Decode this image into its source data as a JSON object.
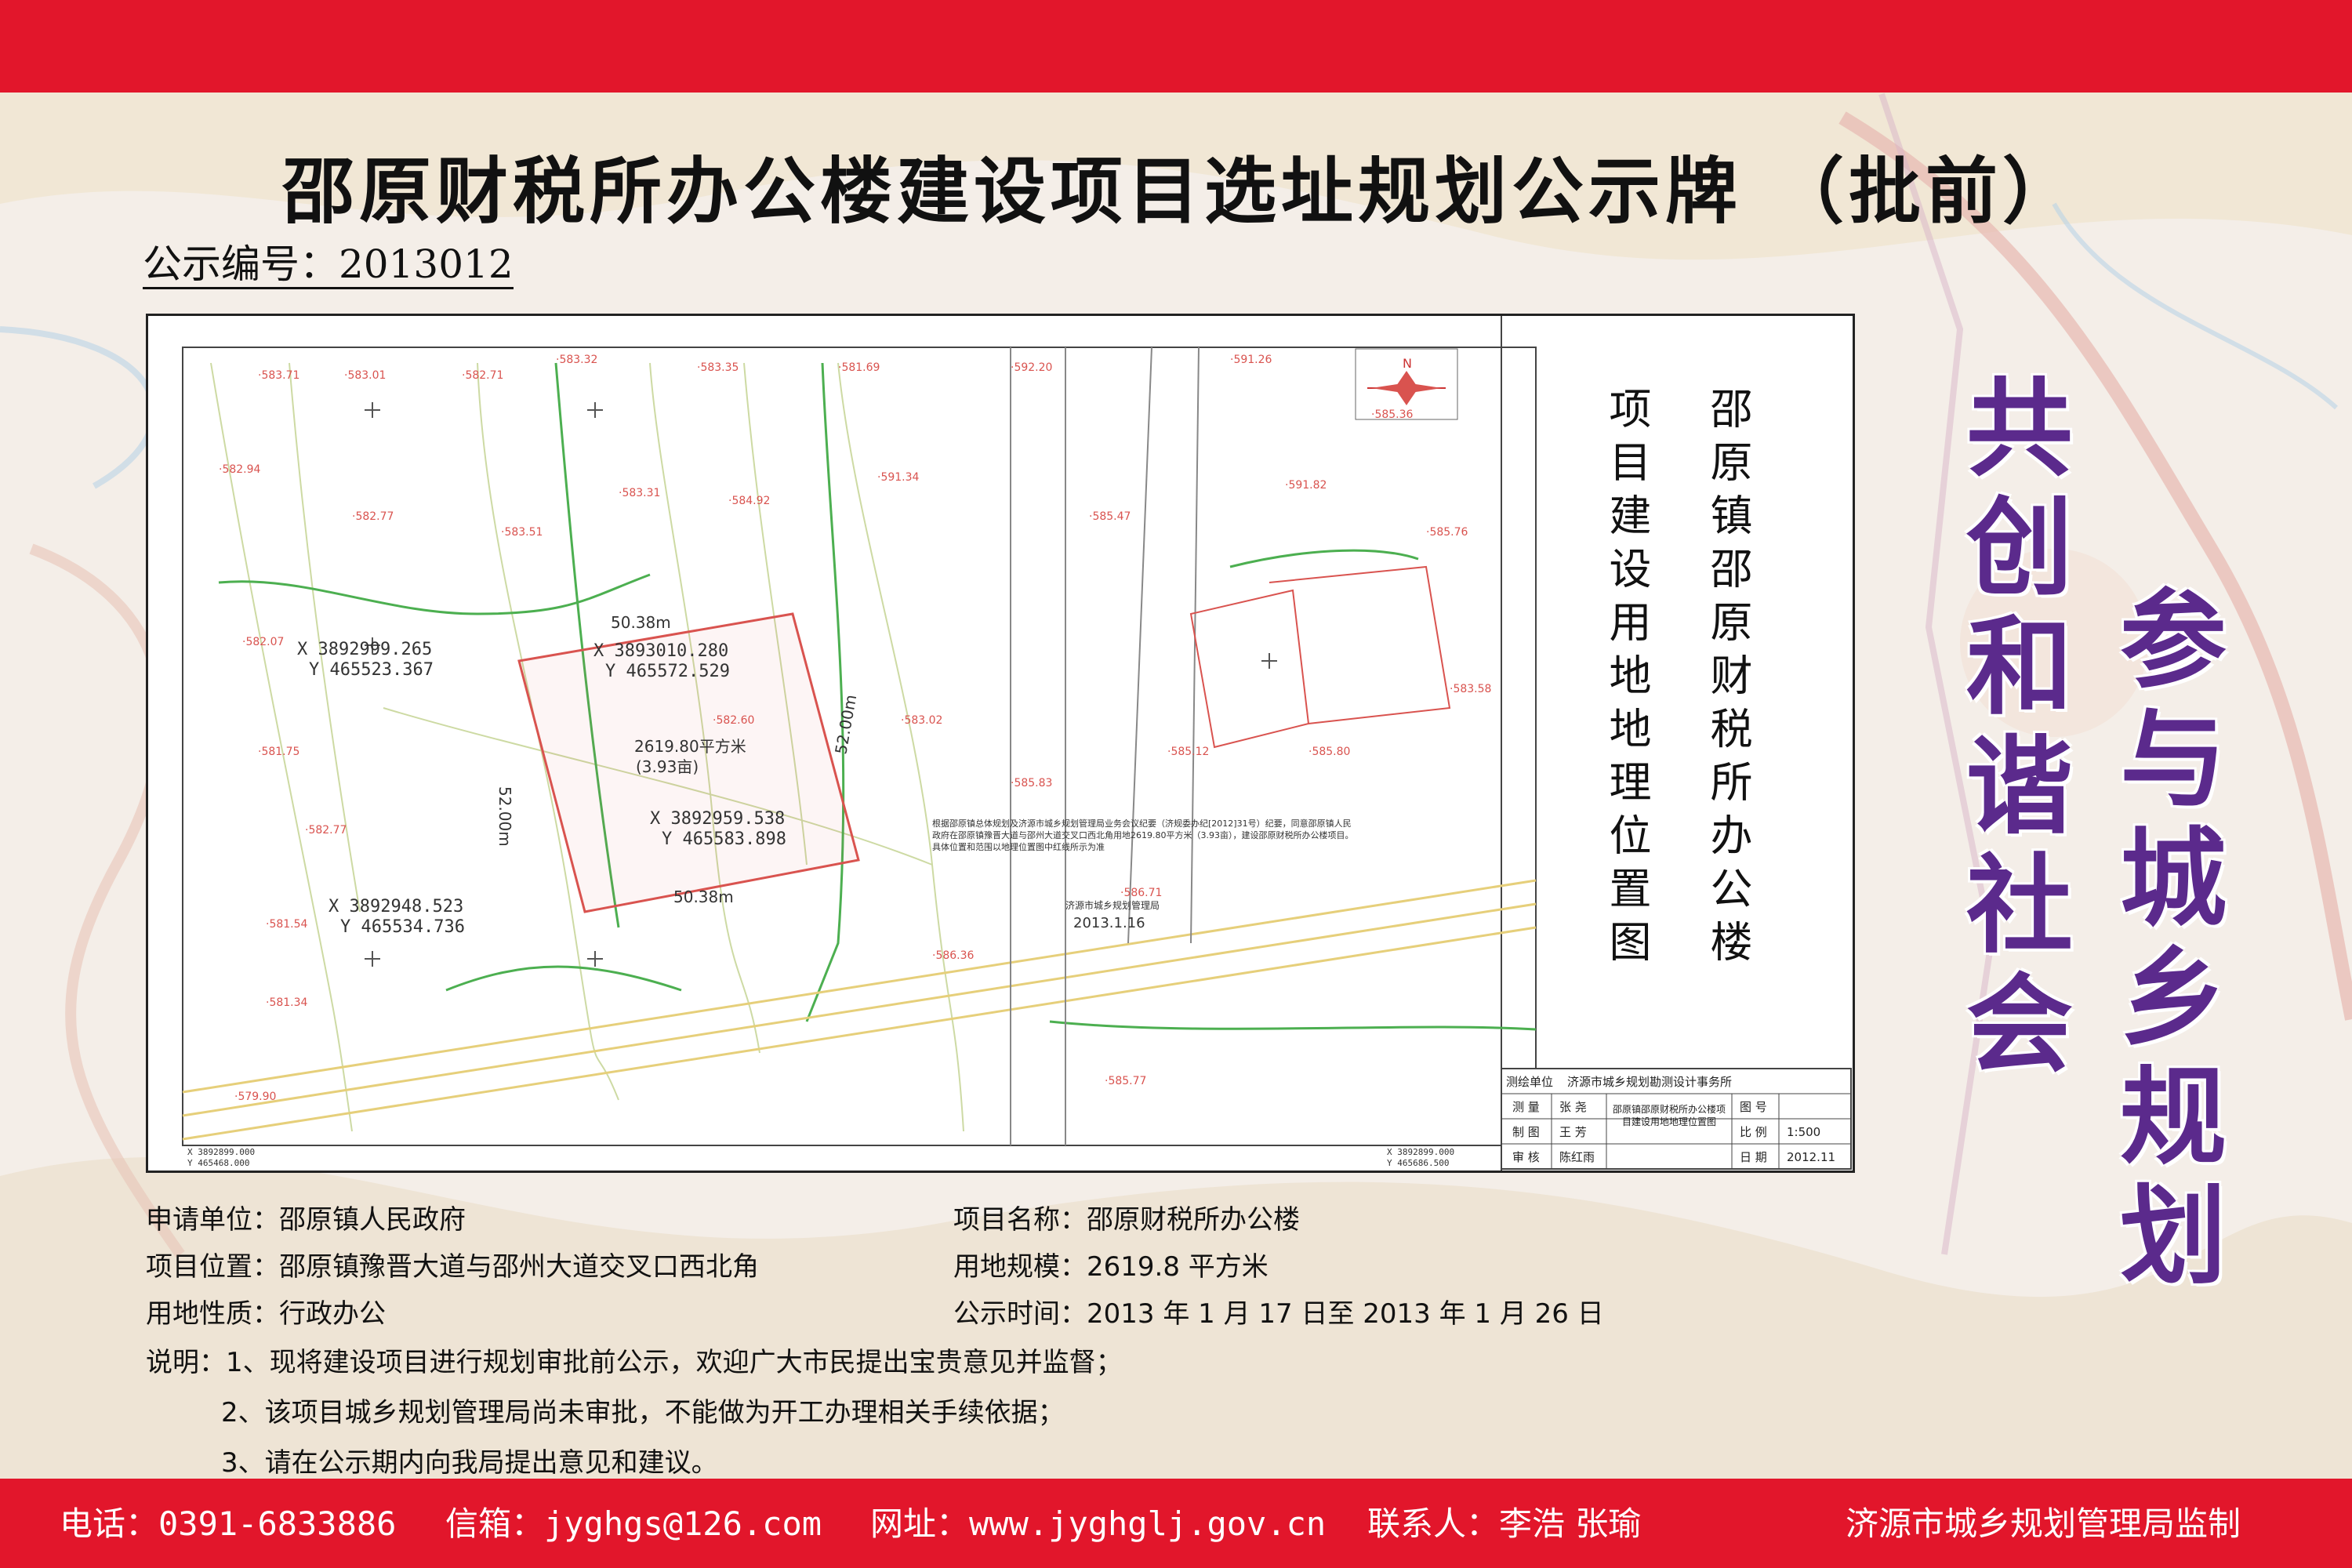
{
  "header": {
    "title": "邵原财税所办公楼建设项目选址规划公示牌 （批前）",
    "notice_label": "公示编号：",
    "notice_number": "2013012"
  },
  "map": {
    "side_title_col1": "邵原镇邵原财税所办公楼",
    "side_title_col2": "项目建设用地地理位置图",
    "coords": [
      {
        "x": "X 3892999.265",
        "y": "Y 465523.367"
      },
      {
        "x": "X 3893010.280",
        "y": "Y 465572.529"
      },
      {
        "x": "X 3892959.538",
        "y": "Y 465583.898"
      },
      {
        "x": "X 3892948.523",
        "y": "Y 465534.736"
      }
    ],
    "dim_top": "50.38m",
    "dim_bottom": "50.38m",
    "dim_left": "52.00m",
    "dim_right": "52.00m",
    "area_label": "2619.80平方米",
    "area_mu": "(3.93亩)",
    "note_text": "根据邵原镇总体规划及济源市城乡规划管理局业务会议纪要（济规委办纪[2012]31号）纪要，同意邵原镇人民政府在邵原镇豫晋大道与邵州大道交叉口西北角用地2619.80平方米（3.93亩），建设邵原财税所办公楼项目。具体位置和范围以地理位置图中红线所示为准",
    "note_org": "济源市城乡规划管理局",
    "note_date": "2013.1.16",
    "corner_bl": "X 3892899.000\nY 465468.000",
    "corner_br": "X 3892899.000\nY 465686.500",
    "title_block": {
      "unit_label": "测绘单位",
      "unit_value": "济源市城乡规划勘测设计事务所",
      "rows": [
        {
          "role": "测 量",
          "name": "张 尧"
        },
        {
          "role": "制 图",
          "name": "王 芳"
        },
        {
          "role": "审 核",
          "name": "陈红雨"
        }
      ],
      "project_desc": "邵原镇邵原财税所办公楼项目建设用地地理位置图",
      "fields": [
        {
          "label": "图 号",
          "value": ""
        },
        {
          "label": "比 例",
          "value": "1:500"
        },
        {
          "label": "日 期",
          "value": "2012.11"
        }
      ]
    }
  },
  "info": {
    "applicant_label": "申请单位：",
    "applicant": "邵原镇人民政府",
    "project_name_label": "项目名称：",
    "project_name": "邵原财税所办公楼",
    "location_label": "项目位置：",
    "location": "邵原镇豫晋大道与邵州大道交叉口西北角",
    "scale_label": "用地规模：",
    "scale": "2619.8 平方米",
    "nature_label": "用地性质：",
    "nature": "行政办公",
    "period_label": "公示时间：",
    "period": "2013 年 1 月 17 日至 2013 年 1 月 26 日",
    "notes": [
      "说明：1、现将建设项目进行规划审批前公示，欢迎广大市民提出宝贵意见并监督；",
      "2、该项目城乡规划管理局尚未审批，不能做为开工办理相关手续依据；",
      "3、请在公示期内向我局提出意见和建议。"
    ]
  },
  "slogans": {
    "left": [
      "共",
      "创",
      "和",
      "谐",
      "社",
      "会"
    ],
    "right": [
      "参",
      "与",
      "城",
      "乡",
      "规",
      "划"
    ]
  },
  "footer": {
    "phone_label": "电话：",
    "phone": "0391-6833886",
    "mail_label": "信箱：",
    "mail": "jyghgs@126.com",
    "web_label": "网址：",
    "web": "www.jyghglj.gov.cn",
    "contact_label": "联系人：",
    "contact": "李浩 张瑜",
    "supervisor": "济源市城乡规划管理局监制"
  },
  "colors": {
    "band_red": "#e2162b",
    "slogan_purple": "#5b2a8c",
    "parcel_red": "#d9534f"
  }
}
